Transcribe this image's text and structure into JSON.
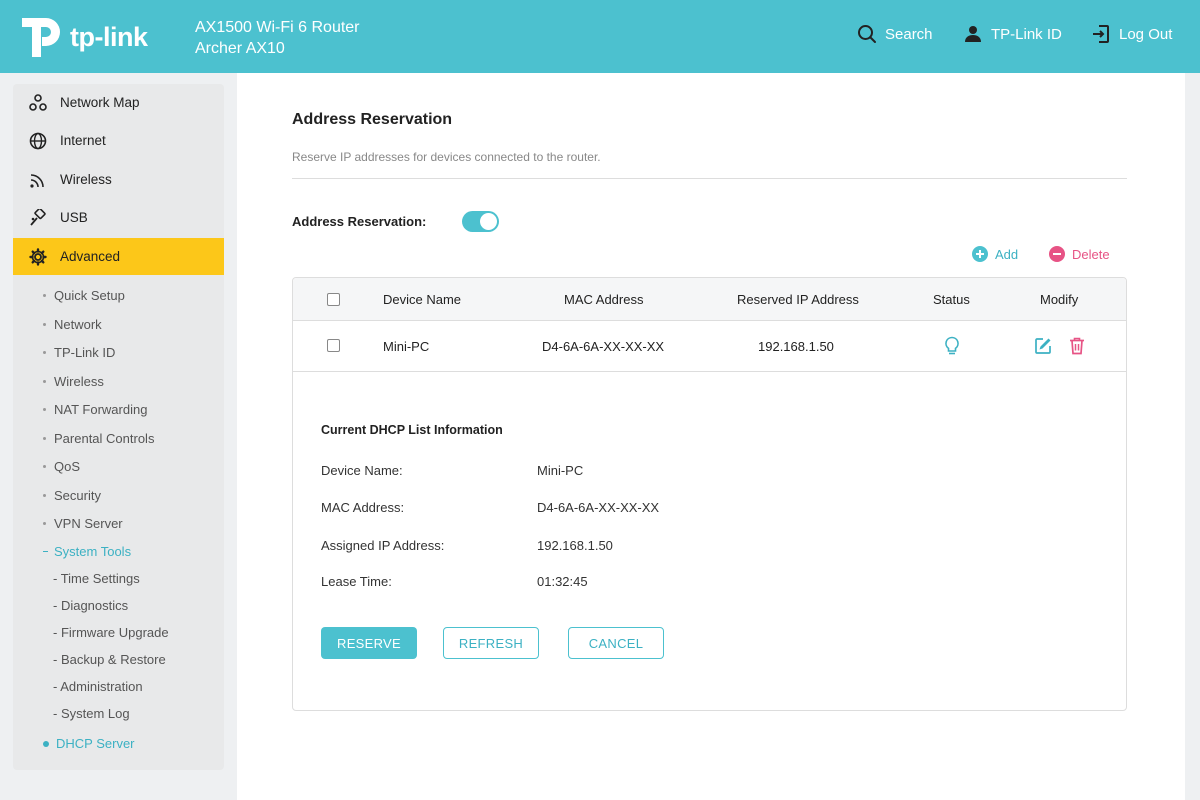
{
  "header": {
    "logo_text": "tp-link",
    "model_line1": "AX1500 Wi-Fi 6 Router",
    "model_line2": "Archer AX10",
    "search_label": "Search",
    "tplink_id_label": "TP-Link ID",
    "logout_label": "Log Out"
  },
  "sidebar": {
    "main_items": [
      {
        "label": "Network Map",
        "icon": "network-map-icon"
      },
      {
        "label": "Internet",
        "icon": "globe-icon"
      },
      {
        "label": "Wireless",
        "icon": "wifi-icon"
      },
      {
        "label": "USB",
        "icon": "usb-icon"
      },
      {
        "label": "Advanced",
        "icon": "gear-icon",
        "active": true
      }
    ],
    "sub_items": [
      "Quick Setup",
      "Network",
      "TP-Link ID",
      "Wireless",
      "NAT Forwarding",
      "Parental Controls",
      "QoS",
      "Security",
      "VPN Server"
    ],
    "system_tools_label": "System Tools",
    "system_tools_items": [
      "- Time Settings",
      "- Diagnostics",
      "- Firmware Upgrade",
      "- Backup & Restore",
      "- Administration",
      "- System Log"
    ],
    "dhcp_server_label": "DHCP Server"
  },
  "main": {
    "title": "Address Reservation",
    "description": "Reserve IP addresses for devices connected to the router.",
    "toggle_label": "Address Reservation:",
    "toggle_on": true,
    "add_label": "Add",
    "delete_label": "Delete",
    "table": {
      "headers": [
        "Device Name",
        "MAC Address",
        "Reserved IP Address",
        "Status",
        "Modify"
      ],
      "rows": [
        {
          "device_name": "Mini-PC",
          "mac": "D4-6A-6A-XX-XX-XX",
          "ip": "192.168.1.50",
          "status_icon": "lightbulb-icon"
        }
      ]
    },
    "dhcp_info": {
      "title": "Current DHCP List Information",
      "fields": [
        {
          "label": "Device Name:",
          "value": "Mini-PC"
        },
        {
          "label": "MAC Address:",
          "value": "D4-6A-6A-XX-XX-XX"
        },
        {
          "label": "Assigned IP Address:",
          "value": "192.168.1.50"
        },
        {
          "label": "Lease Time:",
          "value": "01:32:45"
        }
      ]
    },
    "buttons": {
      "reserve": "RESERVE",
      "refresh": "REFRESH",
      "cancel": "CANCEL"
    }
  },
  "colors": {
    "header_bg": "#4cc1cf",
    "active_nav": "#fcc719",
    "accent": "#3cb1c3",
    "delete": "#e75385"
  }
}
